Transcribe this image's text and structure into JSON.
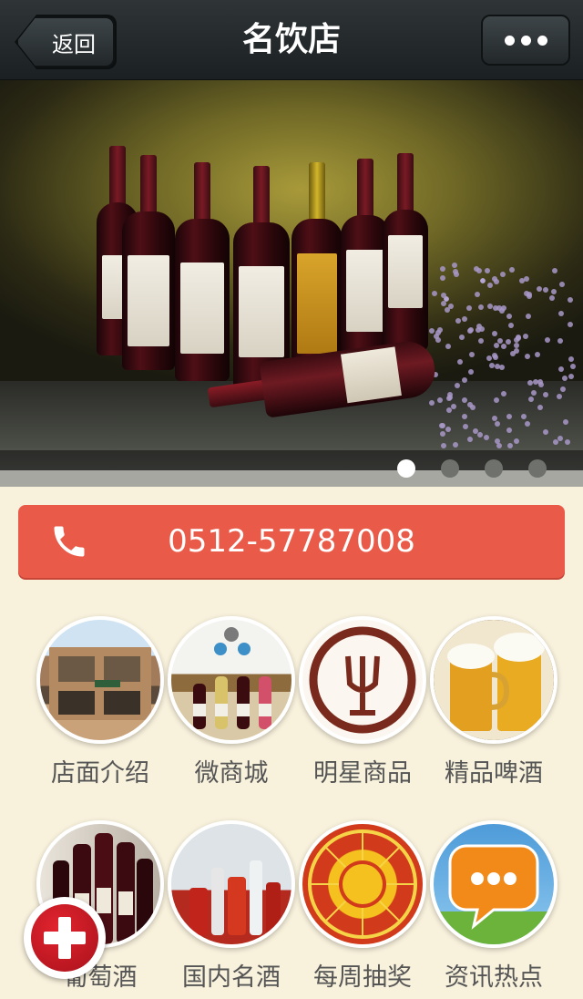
{
  "header": {
    "back_label": "返回",
    "title": "名饮店",
    "more_icon": "more-dots-icon"
  },
  "banner": {
    "slide_count": 4,
    "active_slide": 1
  },
  "contact": {
    "phone": "0512-57787008",
    "icon": "phone-icon",
    "color": "#ea5a48"
  },
  "menu": {
    "items": [
      {
        "label": "店面介绍"
      },
      {
        "label": "微商城"
      },
      {
        "label": "明星商品"
      },
      {
        "label": "精品啤酒"
      },
      {
        "label": "葡萄酒"
      },
      {
        "label": "国内名酒"
      },
      {
        "label": "每周抽奖"
      },
      {
        "label": "资讯热点"
      }
    ]
  },
  "fab": {
    "icon": "plus-icon",
    "color": "#d81e2a"
  },
  "colors": {
    "background": "#f8f1dc",
    "header": "#22282a"
  }
}
